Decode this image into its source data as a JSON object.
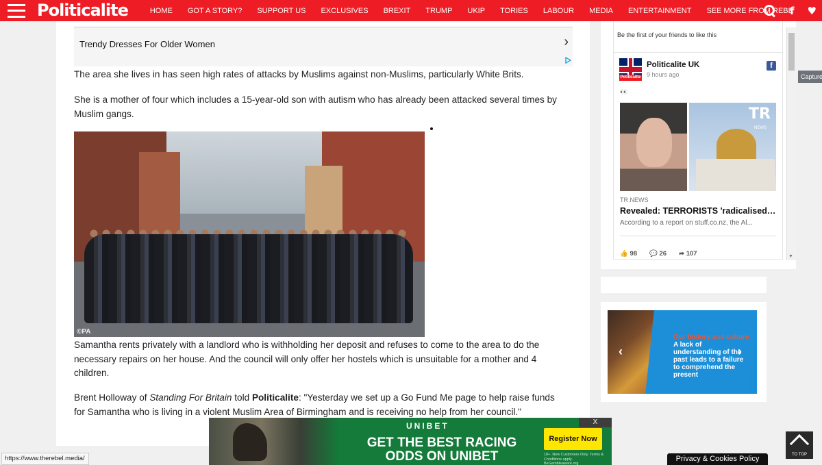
{
  "nav": {
    "logo": "Politicalite",
    "items": [
      "HOME",
      "GOT A STORY?",
      "SUPPORT US",
      "EXCLUSIVES",
      "BREXIT",
      "TRUMP",
      "UKIP",
      "TORIES",
      "LABOUR",
      "MEDIA",
      "ENTERTAINMENT",
      "SEE MORE FROM REBEL ME"
    ],
    "facebook_glyph": "f",
    "twitter_glyph": "♥"
  },
  "ad": {
    "text": "Trendy Dresses For Older Women",
    "chevron": "›"
  },
  "article": {
    "p1": "The area she lives in has seen high rates of attacks by Muslims against non-Muslims, particularly White Brits.",
    "p2": "She is a mother of four which includes a 15-year-old son with autism who has already been attacked several times by Muslim gangs.",
    "photo_credit": "©PA",
    "p3": "Samantha rents privately with a landlord who is withholding her deposit and refuses to come to the area to do the necessary repairs on her house. And the council will only offer her hostels which is unsuitable for a mother and 4 children.",
    "p4_a": "Brent Holloway of ",
    "p4_b": "Standing For Britain",
    "p4_c": " told ",
    "p4_d": "Politicalite",
    "p4_e": ": \"Yesterday we set up a Go Fund Me page to help raise funds for Samantha who is living in a violent Muslim Area of Birmingham and is receiving no help from her council.\""
  },
  "fb": {
    "first_friends": "Be the first of your friends to like this",
    "page_name": "Politicalite UK",
    "avatar_label": "Politicalite",
    "time": "9 hours ago",
    "emoji": "👀",
    "img_logo": "TR",
    "img_sub": "NEWS",
    "source": "TR.NEWS",
    "headline": "Revealed: TERRORISTS 'radicalised in Britain'",
    "desc": "According to a report on stuff.co.nz, the Al...",
    "likes": "98",
    "comments": "26",
    "shares": "107"
  },
  "side_ad": {
    "red_line": "Our history and culture",
    "text": "A lack of understanding of the past leads to a failure to comprehend the present"
  },
  "capture": "Capture",
  "banner": {
    "brand": "UNIBET",
    "headline": "GET THE BEST RACING ODDS ON UNIBET",
    "register": "Register Now",
    "small": "18+. New Customers Only. Terms & Conditions apply. BeGambleaware.org",
    "close": "X"
  },
  "status_url": "https://www.therebel.media/",
  "to_top": "TO TOP",
  "privacy": "Privacy & Cookies Policy"
}
